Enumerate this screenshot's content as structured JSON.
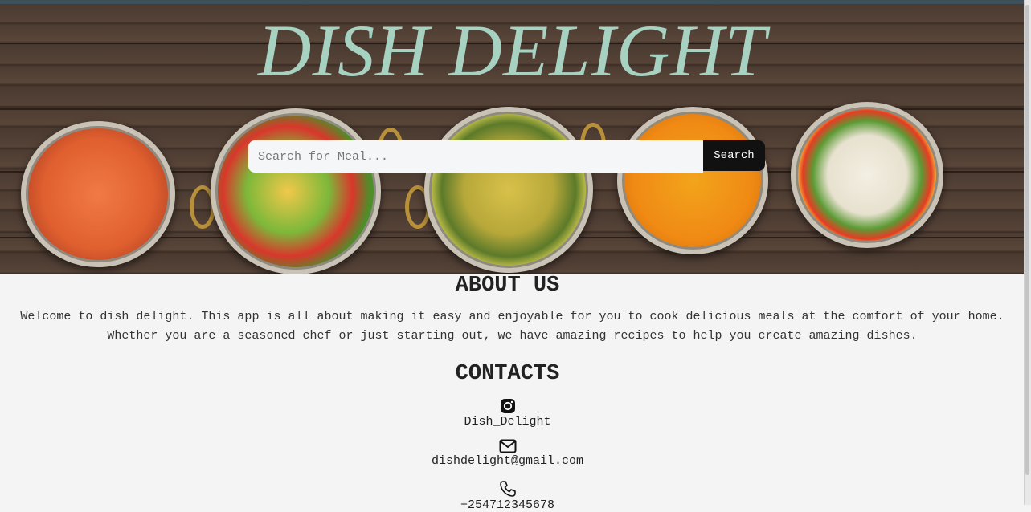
{
  "hero": {
    "title": "DISH DELIGHT",
    "search_placeholder": "Search for Meal...",
    "search_button": "Search"
  },
  "about": {
    "heading": "ABOUT US",
    "text": "Welcome to dish delight. This app is all about making it easy and enjoyable for you to cook delicious meals at the comfort of your home. Whether you are a seasoned chef or just starting out, we have amazing recipes to help you create amazing dishes."
  },
  "contacts": {
    "heading": "CONTACTS",
    "instagram": "Dish_Delight",
    "email": "dishdelight@gmail.com",
    "phone": "+254712345678"
  },
  "colors": {
    "title": "#a7d1c0",
    "search_button_bg": "#111111",
    "page_bg": "#f4f4f4"
  },
  "icons": [
    "instagram-icon",
    "mail-icon",
    "phone-icon"
  ]
}
